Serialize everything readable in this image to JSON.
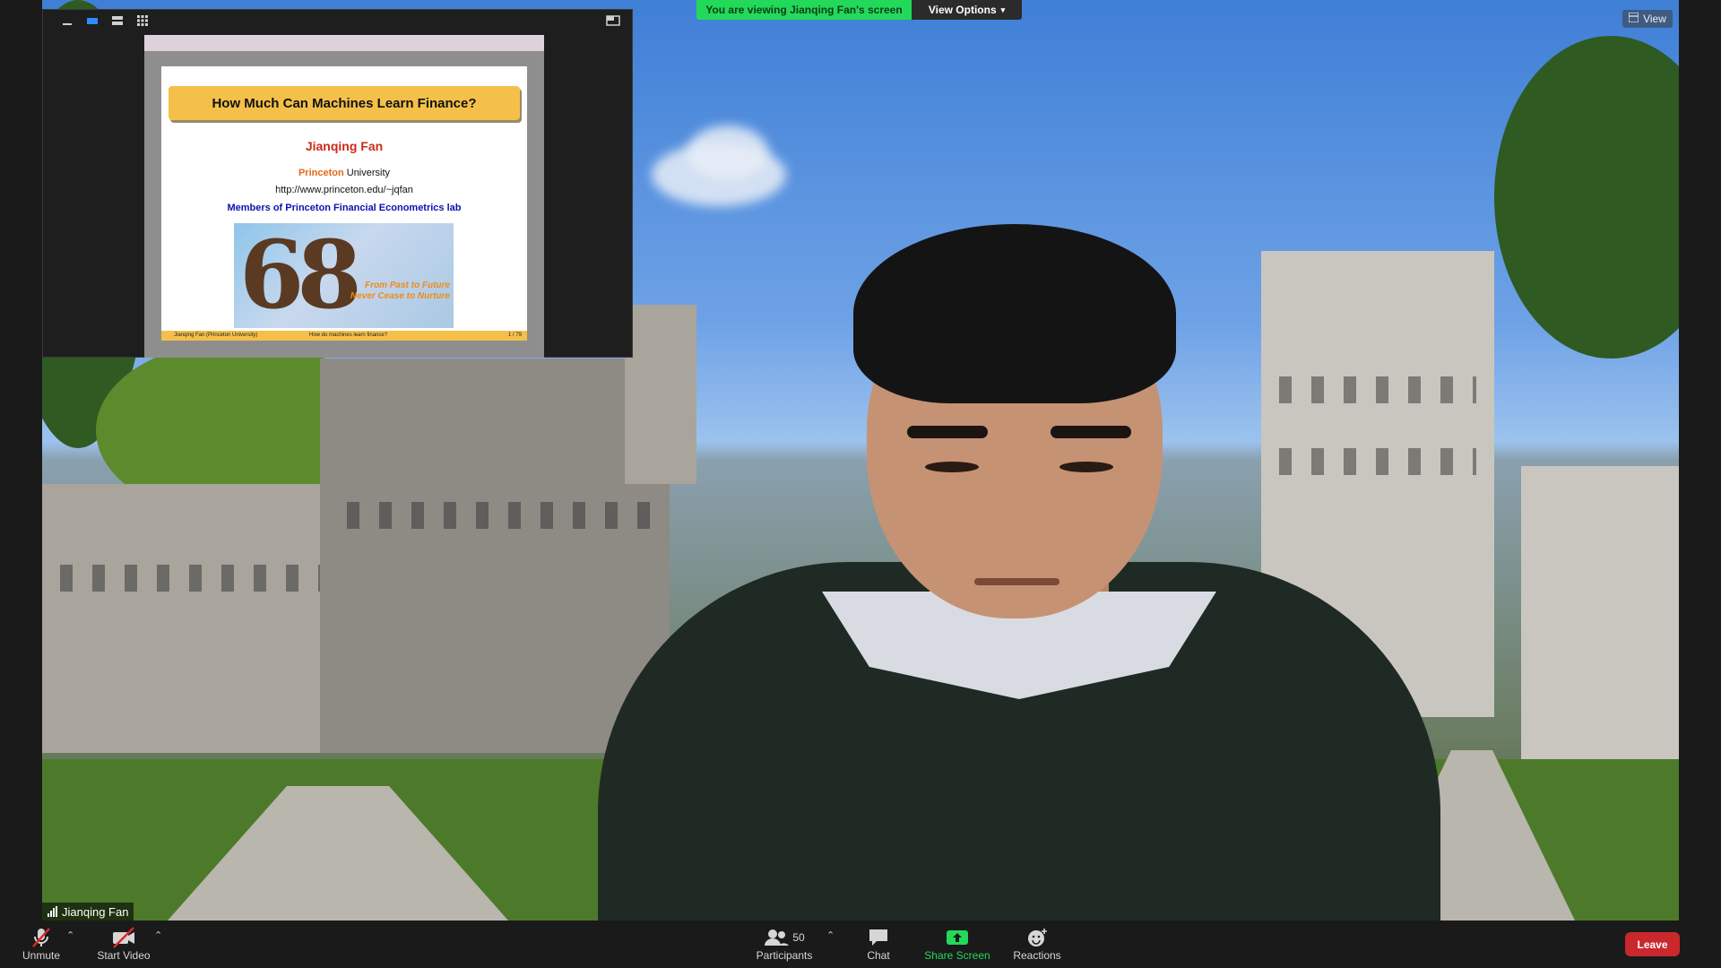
{
  "banner": {
    "viewing_text": "You are viewing Jianqing Fan's screen",
    "view_options_label": "View Options",
    "colors": {
      "green": "#23d959"
    }
  },
  "view_button_label": "View",
  "participant": {
    "name": "Jianqing Fan"
  },
  "shared_slide": {
    "title": "How Much Can Machines Learn Finance?",
    "author": "Jianqing Fan",
    "university_highlight": "Princeton",
    "university_rest": " University",
    "url": "http://www.princeton.edu/~jqfan",
    "lab": "Members of Princeton Financial Econometrics lab",
    "image_number": "68",
    "image_motto_1": "From Past to Future",
    "image_motto_2": "Never Cease to Nurture",
    "footer_author": "Jianqing Fan (Princeton University)",
    "footer_title": "How do machines learn finance?",
    "footer_page": "1 / 79"
  },
  "toolbar": {
    "unmute_label": "Unmute",
    "start_video_label": "Start Video",
    "participants_label": "Participants",
    "participants_count": "50",
    "chat_label": "Chat",
    "share_screen_label": "Share Screen",
    "reactions_label": "Reactions",
    "leave_label": "Leave",
    "colors": {
      "leave": "#c9282d",
      "share": "#23d959"
    }
  }
}
